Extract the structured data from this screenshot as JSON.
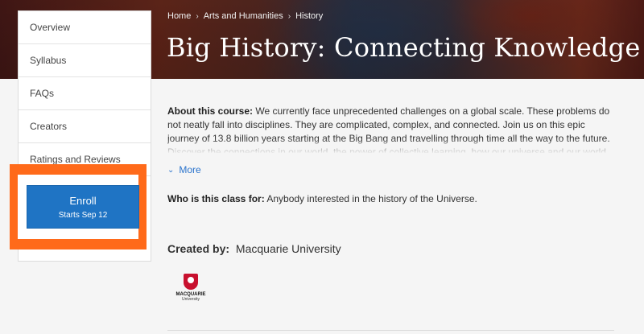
{
  "breadcrumb": {
    "items": [
      "Home",
      "Arts and Humanities",
      "History"
    ],
    "separator_icon": "chevron-right-icon"
  },
  "course": {
    "title": "Big History: Connecting Knowledge"
  },
  "sidebar": {
    "items": [
      {
        "label": "Overview"
      },
      {
        "label": "Syllabus"
      },
      {
        "label": "FAQs"
      },
      {
        "label": "Creators"
      },
      {
        "label": "Ratings and Reviews"
      }
    ]
  },
  "enroll": {
    "label": "Enroll",
    "sub_label": "Starts Sep 12",
    "highlight_color": "#ff6a1a",
    "button_color": "#1f74c4"
  },
  "about": {
    "heading": "About this course:",
    "text": "We currently face unprecedented challenges on a global scale. These problems do not neatly fall into disciplines. They are complicated, complex, and connected. Join us on this epic journey of 13.8 billion years starting at the Big Bang and travelling through time all the way to the future. Discover the connections in our world, the power of collective learning, how our universe and our world has evolved",
    "more_label": "More"
  },
  "audience": {
    "heading": "Who is this class for:",
    "text": "Anybody interested in the history of the Universe."
  },
  "creator": {
    "heading": "Created by:",
    "name": "Macquarie University",
    "logo_line1": "MACQUARIE",
    "logo_line2": "University"
  }
}
